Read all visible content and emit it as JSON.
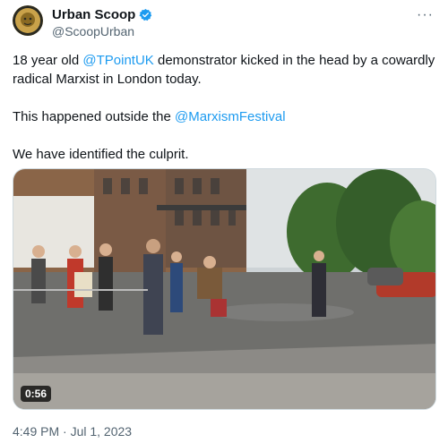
{
  "author": {
    "display_name": "Urban Scoop",
    "handle": "@ScoopUrban",
    "verified_icon": "verified-badge-icon",
    "avatar_icon": "lion-avatar-icon"
  },
  "menu": {
    "more_label": "···"
  },
  "tweet": {
    "line1_prefix": "18 year old ",
    "line1_mention": "@TPointUK",
    "line1_suffix": " demonstrator kicked in the head by a cowardly radical Marxist in London today.",
    "line2_prefix": "This happened outside the ",
    "line2_mention": "@MarxismFestival",
    "line3": "We have identified the culprit."
  },
  "media": {
    "duration": "0:56"
  },
  "timestamp": "4:49 PM · Jul 1, 2023",
  "colors": {
    "link": "#1d9bf0",
    "muted": "#536471",
    "verified": "#1d9bf0"
  }
}
